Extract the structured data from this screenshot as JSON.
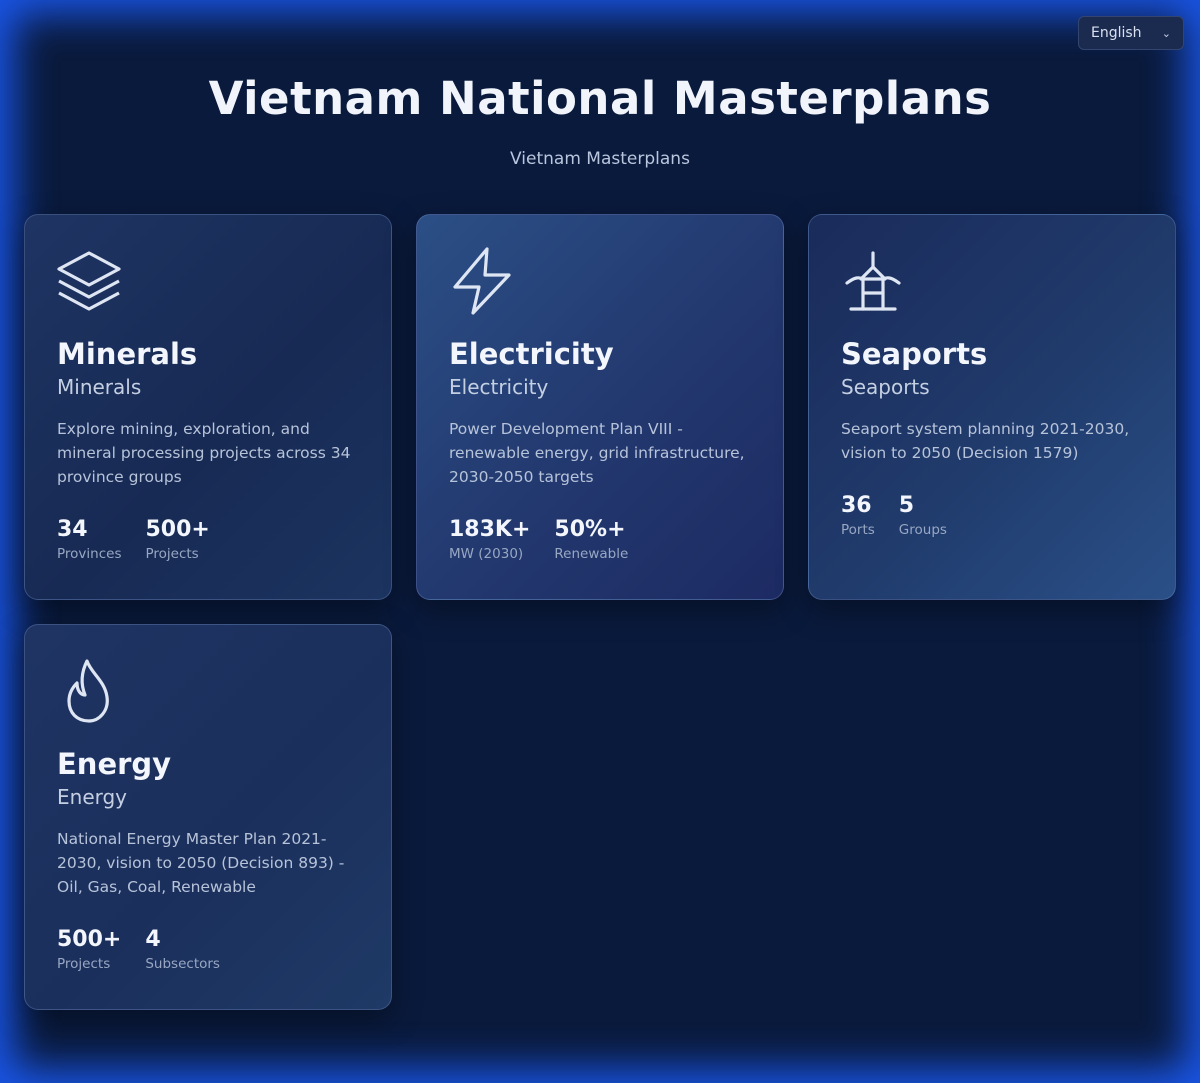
{
  "language_selector": {
    "value": "English"
  },
  "header": {
    "title": "Vietnam National Masterplans",
    "subtitle": "Vietnam Masterplans"
  },
  "cards": [
    {
      "icon": "layers-icon",
      "name": "Minerals",
      "name_local": "Minerals",
      "description": "Explore mining, exploration, and mineral processing projects across 34 province groups",
      "stats": [
        {
          "value": "34",
          "label": "Provinces"
        },
        {
          "value": "500+",
          "label": "Projects"
        }
      ]
    },
    {
      "icon": "lightning-icon",
      "name": "Electricity",
      "name_local": "Electricity",
      "description": "Power Development Plan VIII - renewable energy, grid infrastructure, 2030-2050 targets",
      "stats": [
        {
          "value": "183K+",
          "label": "MW (2030)"
        },
        {
          "value": "50%+",
          "label": "Renewable"
        }
      ]
    },
    {
      "icon": "port-icon",
      "name": "Seaports",
      "name_local": "Seaports",
      "description": "Seaport system planning 2021-2030, vision to 2050 (Decision 1579)",
      "stats": [
        {
          "value": "36",
          "label": "Ports"
        },
        {
          "value": "5",
          "label": "Groups"
        }
      ]
    },
    {
      "icon": "flame-icon",
      "name": "Energy",
      "name_local": "Energy",
      "description": "National Energy Master Plan 2021-2030, vision to 2050 (Decision 893) - Oil, Gas, Coal, Renewable",
      "stats": [
        {
          "value": "500+",
          "label": "Projects"
        },
        {
          "value": "4",
          "label": "Subsectors"
        }
      ]
    }
  ]
}
